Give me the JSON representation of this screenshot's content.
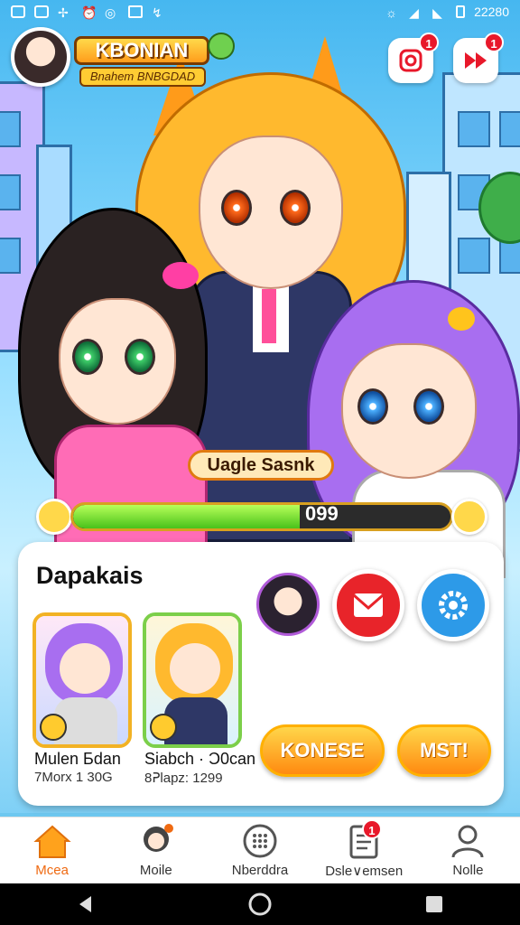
{
  "status_bar": {
    "time": "22280"
  },
  "header": {
    "logo_title": "KBONIAN",
    "logo_subtitle": "Bnahem BNBGDAD",
    "btn_camera_badge": "1",
    "btn_share_badge": "1"
  },
  "hero": {
    "name_tag": "Uagle Sasnk",
    "progress": {
      "value_text": "099",
      "fill_fraction": 0.6
    }
  },
  "panel": {
    "title": "Dapakais",
    "cards": [
      {
        "name": "Mulen Бdan",
        "sub": "7Morx 1 30G"
      },
      {
        "name": "Siabch · Ͻ0can",
        "sub": "8ᕈlapz: 1299"
      }
    ],
    "btn_left_label": "KONESE",
    "btn_right_label": "MST!"
  },
  "bottom_nav": {
    "items": [
      {
        "label": "Mcea",
        "icon": "home-icon",
        "active": true
      },
      {
        "label": "Moile",
        "icon": "character-icon",
        "active": false
      },
      {
        "label": "Nberddra",
        "icon": "grid-icon",
        "active": false
      },
      {
        "label": "Dsle∨emsen",
        "icon": "list-icon",
        "active": false,
        "badge": "1"
      },
      {
        "label": "Nolle",
        "icon": "profile-icon",
        "active": false
      }
    ]
  },
  "colors": {
    "accent": "#ef6a12",
    "badge": "#e8182a",
    "progress": "#48c21a"
  }
}
